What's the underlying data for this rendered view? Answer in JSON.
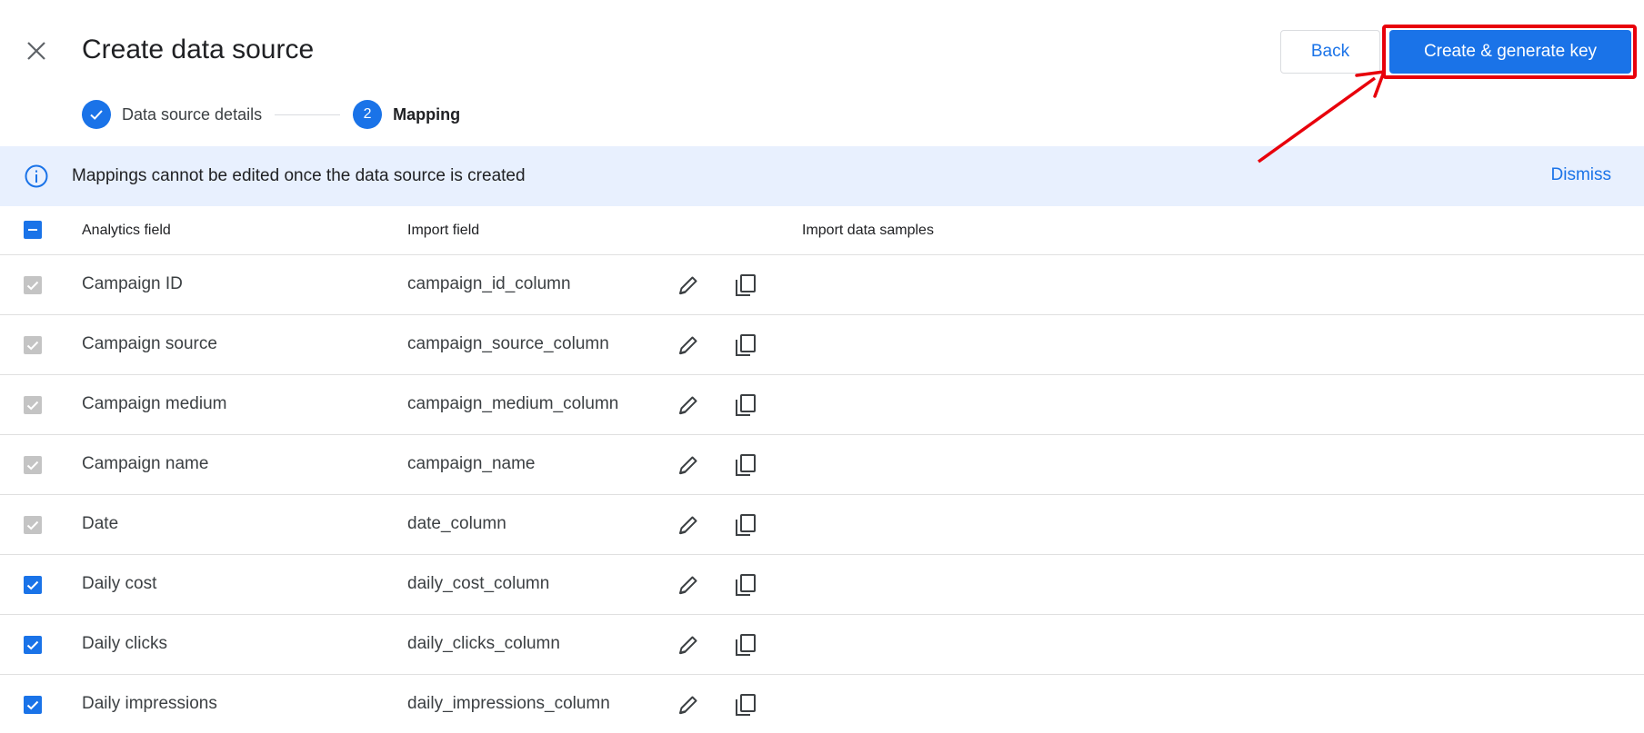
{
  "header": {
    "close_icon": "close-icon",
    "title": "Create data source",
    "back_label": "Back",
    "primary_label": "Create & generate key"
  },
  "stepper": {
    "steps": [
      {
        "label": "Data source details",
        "state": "complete",
        "icon": "check-icon"
      },
      {
        "number": "2",
        "label": "Mapping",
        "state": "active"
      }
    ]
  },
  "banner": {
    "icon": "info-icon",
    "message": "Mappings cannot be edited once the data source is created",
    "dismiss_label": "Dismiss"
  },
  "table": {
    "headers": {
      "analytics_field": "Analytics field",
      "import_field": "Import field",
      "samples": "Import data samples"
    },
    "rows": [
      {
        "analytics_field": "Campaign ID",
        "import_field": "campaign_id_column",
        "checked": true,
        "disabled": true
      },
      {
        "analytics_field": "Campaign source",
        "import_field": "campaign_source_column",
        "checked": true,
        "disabled": true
      },
      {
        "analytics_field": "Campaign medium",
        "import_field": "campaign_medium_column",
        "checked": true,
        "disabled": true
      },
      {
        "analytics_field": "Campaign name",
        "import_field": "campaign_name",
        "checked": true,
        "disabled": true
      },
      {
        "analytics_field": "Date",
        "import_field": "date_column",
        "checked": true,
        "disabled": true
      },
      {
        "analytics_field": "Daily cost",
        "import_field": "daily_cost_column",
        "checked": true,
        "disabled": false
      },
      {
        "analytics_field": "Daily clicks",
        "import_field": "daily_clicks_column",
        "checked": true,
        "disabled": false
      },
      {
        "analytics_field": "Daily impressions",
        "import_field": "daily_impressions_column",
        "checked": true,
        "disabled": false
      }
    ]
  },
  "colors": {
    "accent": "#1a73e8",
    "banner_bg": "#e8f0fe",
    "annotation": "#e8000b",
    "disabled_checkbox": "#c4c4c4"
  }
}
